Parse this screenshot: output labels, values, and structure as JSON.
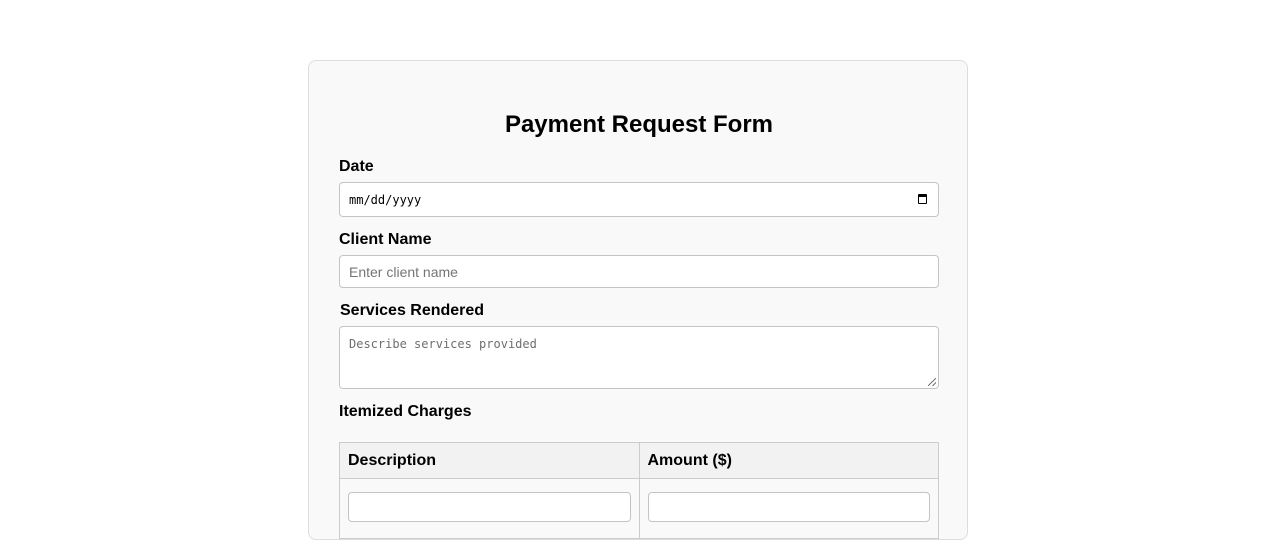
{
  "form": {
    "title": "Payment Request Form",
    "date": {
      "label": "Date",
      "value": "mm/dd/yyyy"
    },
    "client_name": {
      "label": "Client Name",
      "placeholder": "Enter client name"
    },
    "services": {
      "label": "Services Rendered",
      "placeholder": "Describe services provided"
    },
    "charges": {
      "label": "Itemized Charges",
      "columns": [
        "Description",
        "Amount ($)"
      ]
    }
  }
}
